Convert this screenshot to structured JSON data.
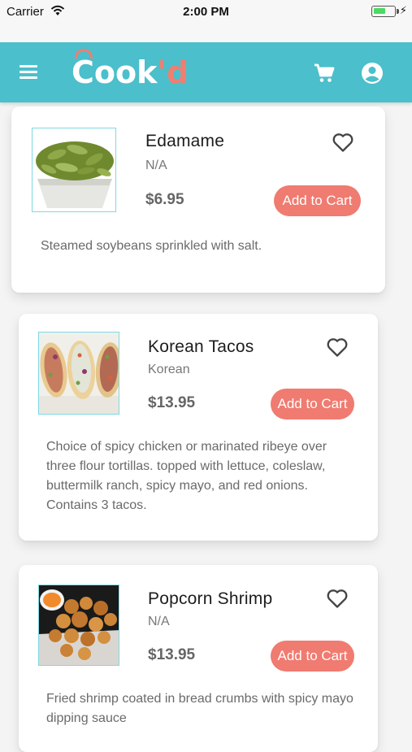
{
  "status_bar": {
    "carrier": "Carrier",
    "time": "2:00 PM"
  },
  "header": {
    "logo_main": "Cook",
    "logo_accent": "'d",
    "brand_color": "#4bbfcb",
    "accent_color": "#ee7f72",
    "icons": [
      "menu-icon",
      "cart-icon",
      "account-icon"
    ]
  },
  "items": [
    {
      "name": "Edamame",
      "category": "N/A",
      "price": "$6.95",
      "button": "Add to Cart",
      "description": "Steamed soybeans sprinkled with salt."
    },
    {
      "name": "Korean Tacos",
      "category": "Korean",
      "price": "$13.95",
      "button": "Add to Cart",
      "description": "Choice of spicy chicken or marinated ribeye over three flour tortillas. topped with lettuce, coleslaw, buttermilk ranch, spicy mayo, and red onions. Contains 3 tacos."
    },
    {
      "name": "Popcorn Shrimp",
      "category": "N/A",
      "price": "$13.95",
      "button": "Add to Cart",
      "description": "Fried shrimp coated in bread crumbs with spicy mayo dipping sauce"
    }
  ]
}
